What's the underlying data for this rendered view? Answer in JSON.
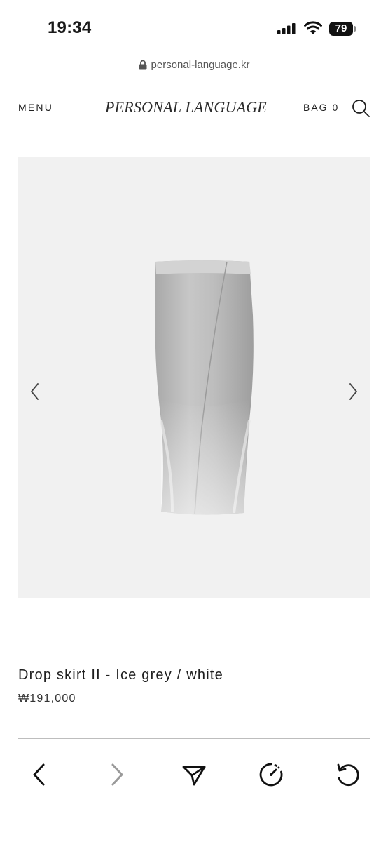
{
  "status_bar": {
    "time": "19:34",
    "battery": "79"
  },
  "browser": {
    "url": "personal-language.kr"
  },
  "header": {
    "menu_label": "MENU",
    "logo_text": "PERSONAL LANGUAGE",
    "bag_label": "BAG 0"
  },
  "product": {
    "title": "Drop skirt II - Ice grey / white",
    "price": "₩191,000"
  },
  "colors": {
    "image_background": "#f1f1f1",
    "text": "#1f1f1f"
  },
  "icons": {
    "header": [
      "search-icon"
    ],
    "gallery": [
      "chevron-left-icon",
      "chevron-right-icon"
    ],
    "toolbar": [
      "back-icon",
      "forward-icon",
      "share-icon",
      "speed-icon",
      "reload-icon"
    ]
  }
}
